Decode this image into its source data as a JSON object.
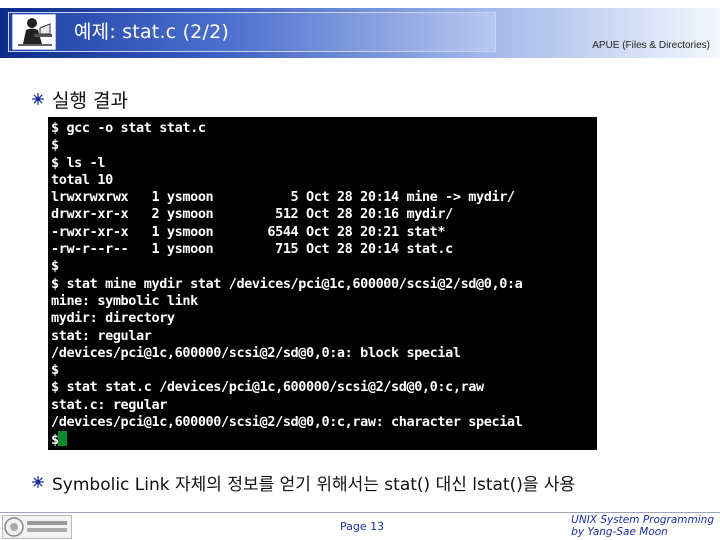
{
  "header": {
    "title": "예제: stat.c (2/2)",
    "course_label": "APUE (Files & Directories)"
  },
  "bullets": [
    {
      "icon": "sparkle-icon",
      "text": "실행 결과"
    },
    {
      "icon": "sparkle-icon",
      "text": "Symbolic Link 자체의 정보를 얻기 위해서는 stat() 대신 lstat()을 사용"
    }
  ],
  "terminal": {
    "lines": [
      "$ gcc -o stat stat.c",
      "$",
      "$ ls -l",
      "total 10",
      "lrwxrwxrwx   1 ysmoon          5 Oct 28 20:14 mine -> mydir/",
      "drwxr-xr-x   2 ysmoon        512 Oct 28 20:16 mydir/",
      "-rwxr-xr-x   1 ysmoon       6544 Oct 28 20:21 stat*",
      "-rw-r--r--   1 ysmoon        715 Oct 28 20:14 stat.c",
      "$",
      "$ stat mine mydir stat /devices/pci@1c,600000/scsi@2/sd@0,0:a",
      "mine: symbolic link",
      "mydir: directory",
      "stat: regular",
      "/devices/pci@1c,600000/scsi@2/sd@0,0:a: block special",
      "$",
      "$ stat stat.c /devices/pci@1c,600000/scsi@2/sd@0,0:c,raw",
      "stat.c: regular",
      "/devices/pci@1c,600000/scsi@2/sd@0,0:c,raw: character special",
      "$"
    ],
    "background": "#000000",
    "text_color": "#ffffff",
    "cursor_color": "#0b8a2e"
  },
  "footer": {
    "page": "Page 13",
    "credit_line1": "UNIX System Programming",
    "credit_line2": "by Yang-Sae Moon",
    "logo_icon": "university-logo-icon"
  },
  "colors": {
    "header_dark": "#0d2c8a",
    "accent_text": "#1a2fa0"
  }
}
